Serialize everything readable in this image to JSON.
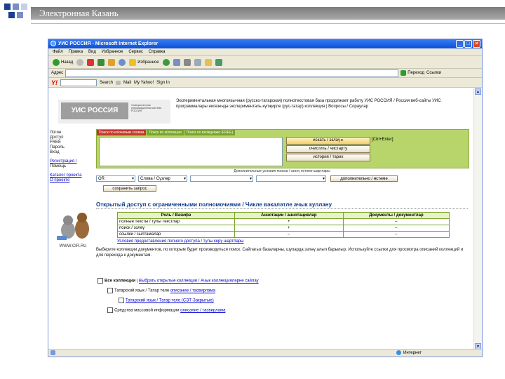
{
  "slide": {
    "title": "Электронная Казань",
    "square_colors": [
      "#1c3f94",
      "#7a8ec4",
      "#c7cfe6"
    ]
  },
  "browser": {
    "window_title": "УИС РОССИЯ - Microsoft Internet Explorer",
    "menu": [
      "Файл",
      "Правка",
      "Вид",
      "Избранное",
      "Сервис",
      "Справка"
    ],
    "toolbar": {
      "back": "Назад",
      "favorites": "Избранное"
    },
    "address_label": "Адрес",
    "go_label": "Переход",
    "links_label": "Ссылки",
    "yahoo": {
      "search_btn": "Search",
      "mail": "Mail",
      "my_yahoo": "My Yahoo!",
      "sign_in": "Sign In"
    },
    "status": "Интернет"
  },
  "page": {
    "logo_text": "УИС РОССИЯ",
    "logo_sub": "Университетская информационная система РОССИЯ",
    "intro": "Экспериментальная многоязычная (русско-татарская) полнотекстовая база продолжает работу УИС РОССИЯ / Россия веб-сайты УИС программалары нигезендә эксперименталь күпҗирле (рус-татар) коллекция | Вопросы / Сораулар",
    "sidebar_lines": [
      "Логин",
      "Доступ",
      "FREE",
      "Пароль",
      "Вход",
      "Регистрация",
      "Помощь"
    ],
    "sidebar_links": [
      "Регистрация /",
      "Каталог проекта",
      "О проекте"
    ],
    "mascot_caption": "WWW.CIR.RU",
    "tabs": [
      "Поиск по ключевым словам",
      "Поиск по коллекции",
      "Поиск по вхождению (FREE)"
    ],
    "buttons": [
      "искать / эзләү ▸",
      "очистить / чистарту",
      "история / тарих"
    ],
    "side_label": "[Ctrl+Enter]",
    "search_note": "Дополнительные условия поиска / эзләү өстәмә шартлары",
    "select1": "OR",
    "select2": "Слова / Сүзләр",
    "extended_btn": "дополнительно / өстәмә",
    "save_btn": "сохранить запрос",
    "section_title": "Открытый доступ с ограниченными полномочиями / Чикле вәкаләтле ачык куллану",
    "table": {
      "headers": [
        "Роль / Вәзифә",
        "Аннотации / аннотацияләр",
        "Документы / документлар"
      ],
      "rows": [
        [
          "полные тексты / тулы текстлар",
          "+",
          "–"
        ],
        [
          "поиск / эзләү",
          "+",
          "–"
        ],
        [
          "ссылки / сылтамалар",
          "–",
          "–"
        ]
      ]
    },
    "table_link": "Условия предоставления полного доступа / тулы керү шартлары",
    "para": "Выберите коллекции документов, по которым будет производиться поиск. Сайлагыз базаларны, шуларда эзләү алып барылыр. Используйте ссылки для просмотра описаний коллекций и для перехода к документам.",
    "collections": [
      {
        "label": "Все коллекции",
        "link": "Выбрать открытые коллекции / Ачык коллекцияләрне сайлау"
      },
      {
        "label": "Татарский язык / Татар теле",
        "link": "описание / тасвирлама"
      },
      {
        "label": "Татарский язык / Татар теле (СЭТ-Закрытые)",
        "link": ""
      },
      {
        "label": "Средства массовой информации",
        "link": "описание / тасвирлама"
      }
    ]
  }
}
